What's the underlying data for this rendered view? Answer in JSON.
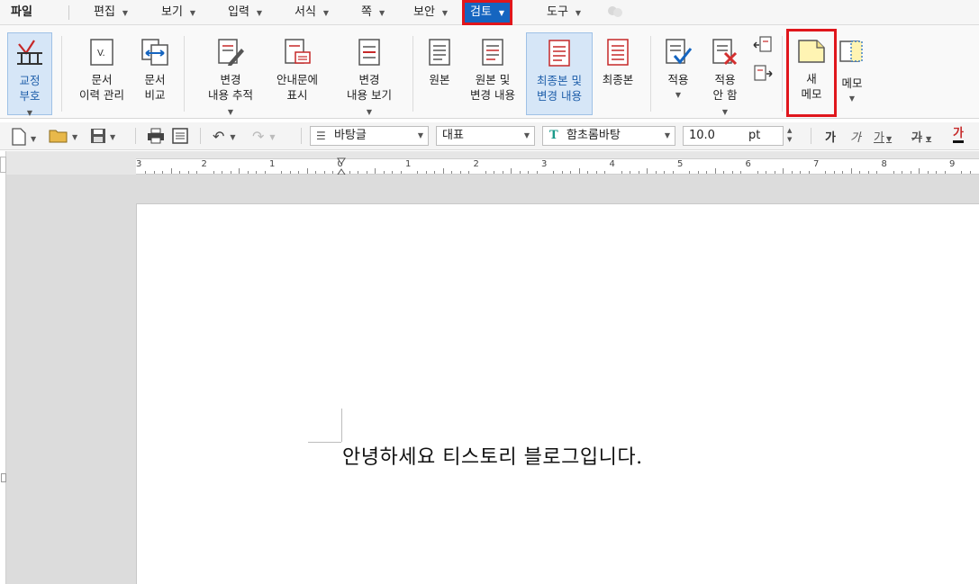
{
  "menubar": {
    "file": "파일",
    "edit": "편집",
    "view": "보기",
    "insert": "입력",
    "format": "서식",
    "page": "쪽",
    "security": "보안",
    "review": "검토",
    "tools": "도구"
  },
  "ribbon": {
    "proofmark": [
      "교정",
      "부호"
    ],
    "doc_history": [
      "문서",
      "이력 관리"
    ],
    "doc_compare": [
      "문서",
      "비교"
    ],
    "track_changes": [
      "변경",
      "내용 추적"
    ],
    "show_in_balloon": [
      "안내문에",
      "표시"
    ],
    "show_changes": [
      "변경",
      "내용 보기"
    ],
    "original": "원본",
    "original_changes": [
      "원본 및",
      "변경 내용"
    ],
    "final_changes": [
      "최종본 및",
      "변경 내용"
    ],
    "final": "최종본",
    "accept": "적용",
    "reject": [
      "적용",
      "안 함"
    ],
    "new_memo": [
      "새",
      "메모"
    ],
    "memo": "메모"
  },
  "toolbar": {
    "style": "바탕글",
    "lang": "대표",
    "font": "함초롬바탕",
    "size": "10.0",
    "unit": "pt"
  },
  "ruler": {
    "numbers": [
      "3",
      "2",
      "1",
      "0",
      "1",
      "2",
      "3",
      "4",
      "5",
      "6",
      "7",
      "8",
      "9"
    ]
  },
  "document": {
    "text": "안녕하세요 티스토리 블로그입니다."
  },
  "colors": {
    "accent": "#1565c0",
    "highlight": "#e0161c",
    "selected_bg": "#d6e6f7"
  }
}
